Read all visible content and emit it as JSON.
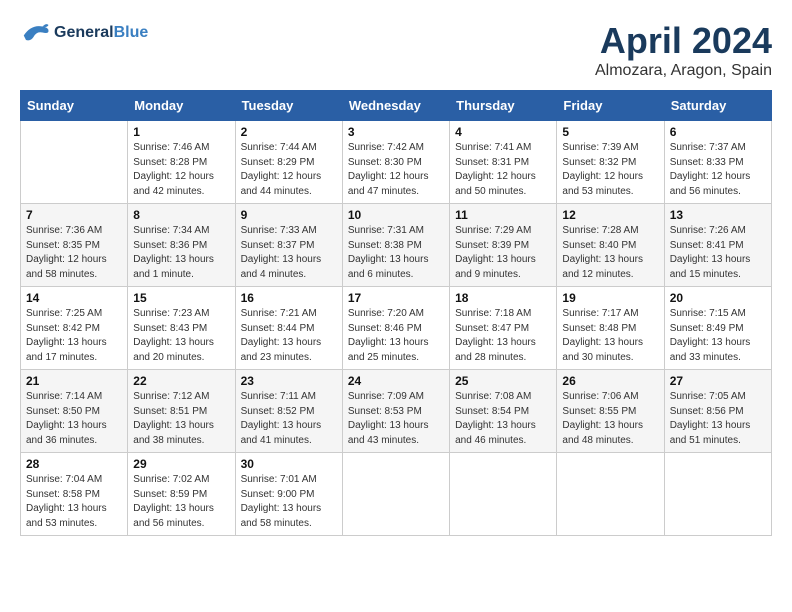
{
  "header": {
    "logo_line1": "General",
    "logo_line2": "Blue",
    "month": "April 2024",
    "location": "Almozara, Aragon, Spain"
  },
  "weekdays": [
    "Sunday",
    "Monday",
    "Tuesday",
    "Wednesday",
    "Thursday",
    "Friday",
    "Saturday"
  ],
  "weeks": [
    [
      {
        "day": "",
        "info": ""
      },
      {
        "day": "1",
        "info": "Sunrise: 7:46 AM\nSunset: 8:28 PM\nDaylight: 12 hours\nand 42 minutes."
      },
      {
        "day": "2",
        "info": "Sunrise: 7:44 AM\nSunset: 8:29 PM\nDaylight: 12 hours\nand 44 minutes."
      },
      {
        "day": "3",
        "info": "Sunrise: 7:42 AM\nSunset: 8:30 PM\nDaylight: 12 hours\nand 47 minutes."
      },
      {
        "day": "4",
        "info": "Sunrise: 7:41 AM\nSunset: 8:31 PM\nDaylight: 12 hours\nand 50 minutes."
      },
      {
        "day": "5",
        "info": "Sunrise: 7:39 AM\nSunset: 8:32 PM\nDaylight: 12 hours\nand 53 minutes."
      },
      {
        "day": "6",
        "info": "Sunrise: 7:37 AM\nSunset: 8:33 PM\nDaylight: 12 hours\nand 56 minutes."
      }
    ],
    [
      {
        "day": "7",
        "info": "Sunrise: 7:36 AM\nSunset: 8:35 PM\nDaylight: 12 hours\nand 58 minutes."
      },
      {
        "day": "8",
        "info": "Sunrise: 7:34 AM\nSunset: 8:36 PM\nDaylight: 13 hours\nand 1 minute."
      },
      {
        "day": "9",
        "info": "Sunrise: 7:33 AM\nSunset: 8:37 PM\nDaylight: 13 hours\nand 4 minutes."
      },
      {
        "day": "10",
        "info": "Sunrise: 7:31 AM\nSunset: 8:38 PM\nDaylight: 13 hours\nand 6 minutes."
      },
      {
        "day": "11",
        "info": "Sunrise: 7:29 AM\nSunset: 8:39 PM\nDaylight: 13 hours\nand 9 minutes."
      },
      {
        "day": "12",
        "info": "Sunrise: 7:28 AM\nSunset: 8:40 PM\nDaylight: 13 hours\nand 12 minutes."
      },
      {
        "day": "13",
        "info": "Sunrise: 7:26 AM\nSunset: 8:41 PM\nDaylight: 13 hours\nand 15 minutes."
      }
    ],
    [
      {
        "day": "14",
        "info": "Sunrise: 7:25 AM\nSunset: 8:42 PM\nDaylight: 13 hours\nand 17 minutes."
      },
      {
        "day": "15",
        "info": "Sunrise: 7:23 AM\nSunset: 8:43 PM\nDaylight: 13 hours\nand 20 minutes."
      },
      {
        "day": "16",
        "info": "Sunrise: 7:21 AM\nSunset: 8:44 PM\nDaylight: 13 hours\nand 23 minutes."
      },
      {
        "day": "17",
        "info": "Sunrise: 7:20 AM\nSunset: 8:46 PM\nDaylight: 13 hours\nand 25 minutes."
      },
      {
        "day": "18",
        "info": "Sunrise: 7:18 AM\nSunset: 8:47 PM\nDaylight: 13 hours\nand 28 minutes."
      },
      {
        "day": "19",
        "info": "Sunrise: 7:17 AM\nSunset: 8:48 PM\nDaylight: 13 hours\nand 30 minutes."
      },
      {
        "day": "20",
        "info": "Sunrise: 7:15 AM\nSunset: 8:49 PM\nDaylight: 13 hours\nand 33 minutes."
      }
    ],
    [
      {
        "day": "21",
        "info": "Sunrise: 7:14 AM\nSunset: 8:50 PM\nDaylight: 13 hours\nand 36 minutes."
      },
      {
        "day": "22",
        "info": "Sunrise: 7:12 AM\nSunset: 8:51 PM\nDaylight: 13 hours\nand 38 minutes."
      },
      {
        "day": "23",
        "info": "Sunrise: 7:11 AM\nSunset: 8:52 PM\nDaylight: 13 hours\nand 41 minutes."
      },
      {
        "day": "24",
        "info": "Sunrise: 7:09 AM\nSunset: 8:53 PM\nDaylight: 13 hours\nand 43 minutes."
      },
      {
        "day": "25",
        "info": "Sunrise: 7:08 AM\nSunset: 8:54 PM\nDaylight: 13 hours\nand 46 minutes."
      },
      {
        "day": "26",
        "info": "Sunrise: 7:06 AM\nSunset: 8:55 PM\nDaylight: 13 hours\nand 48 minutes."
      },
      {
        "day": "27",
        "info": "Sunrise: 7:05 AM\nSunset: 8:56 PM\nDaylight: 13 hours\nand 51 minutes."
      }
    ],
    [
      {
        "day": "28",
        "info": "Sunrise: 7:04 AM\nSunset: 8:58 PM\nDaylight: 13 hours\nand 53 minutes."
      },
      {
        "day": "29",
        "info": "Sunrise: 7:02 AM\nSunset: 8:59 PM\nDaylight: 13 hours\nand 56 minutes."
      },
      {
        "day": "30",
        "info": "Sunrise: 7:01 AM\nSunset: 9:00 PM\nDaylight: 13 hours\nand 58 minutes."
      },
      {
        "day": "",
        "info": ""
      },
      {
        "day": "",
        "info": ""
      },
      {
        "day": "",
        "info": ""
      },
      {
        "day": "",
        "info": ""
      }
    ]
  ]
}
